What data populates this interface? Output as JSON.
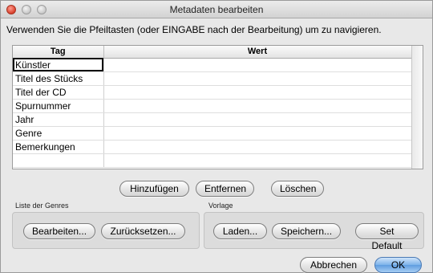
{
  "window": {
    "title": "Metadaten bearbeiten"
  },
  "instruction": "Verwenden Sie die Pfeiltasten (oder EINGABE nach der Bearbeitung) um zu navigieren.",
  "table": {
    "headers": {
      "tag": "Tag",
      "wert": "Wert"
    },
    "rows": [
      {
        "tag": "Künstler",
        "wert": ""
      },
      {
        "tag": "Titel des Stücks",
        "wert": ""
      },
      {
        "tag": "Titel der CD",
        "wert": ""
      },
      {
        "tag": "Spurnummer",
        "wert": ""
      },
      {
        "tag": "Jahr",
        "wert": ""
      },
      {
        "tag": "Genre",
        "wert": ""
      },
      {
        "tag": "Bemerkungen",
        "wert": ""
      },
      {
        "tag": "",
        "wert": ""
      }
    ]
  },
  "actions": {
    "add": "Hinzufügen",
    "remove": "Entfernen",
    "clear": "Löschen"
  },
  "genres": {
    "label": "Liste der Genres",
    "edit": "Bearbeiten...",
    "reset": "Zurücksetzen..."
  },
  "template": {
    "label": "Vorlage",
    "load": "Laden...",
    "save": "Speichern...",
    "set_default": "Set Default"
  },
  "footer": {
    "cancel": "Abbrechen",
    "ok": "OK"
  }
}
